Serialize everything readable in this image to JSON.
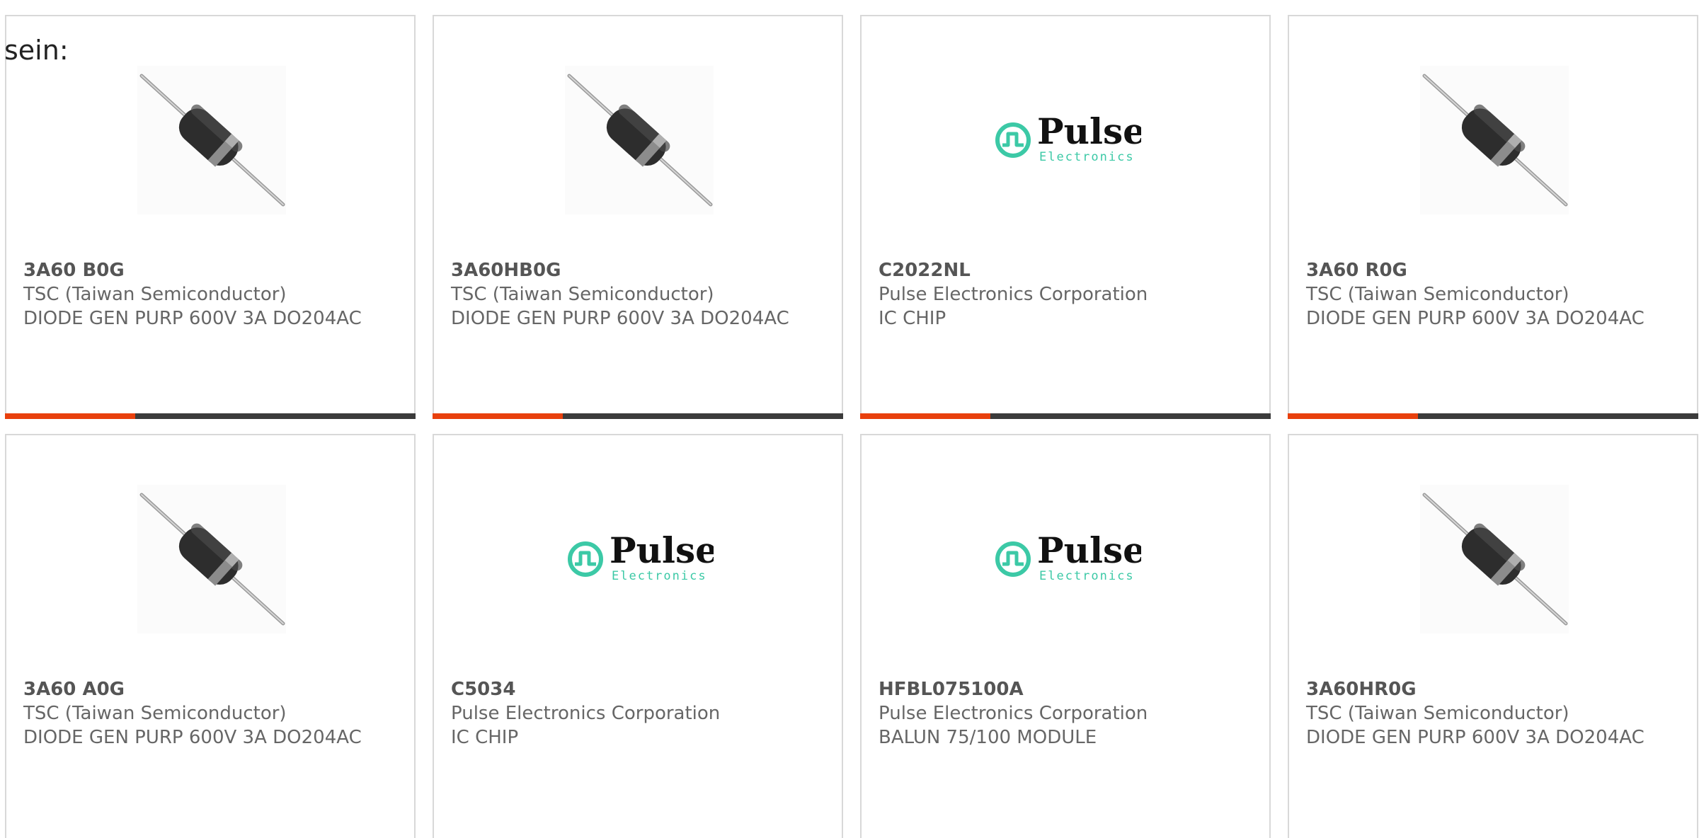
{
  "intro_text": "sein:",
  "colors": {
    "accent": "#e8400d",
    "bar": "#3b3b3b",
    "border": "#d8d8d8",
    "pulse_teal": "#3cc9a6"
  },
  "products": [
    {
      "part": "3A60 B0G",
      "manufacturer": "TSC (Taiwan Semiconductor)",
      "description": "DIODE GEN PURP 600V 3A DO204AC",
      "image": "diode-icon"
    },
    {
      "part": "3A60HB0G",
      "manufacturer": "TSC (Taiwan Semiconductor)",
      "description": "DIODE GEN PURP 600V 3A DO204AC",
      "image": "diode-icon"
    },
    {
      "part": "C2022NL",
      "manufacturer": "Pulse Electronics Corporation",
      "description": "IC CHIP",
      "image": "pulse-logo"
    },
    {
      "part": "3A60 R0G",
      "manufacturer": "TSC (Taiwan Semiconductor)",
      "description": "DIODE GEN PURP 600V 3A DO204AC",
      "image": "diode-icon"
    },
    {
      "part": "3A60 A0G",
      "manufacturer": "TSC (Taiwan Semiconductor)",
      "description": "DIODE GEN PURP 600V 3A DO204AC",
      "image": "diode-icon"
    },
    {
      "part": "C5034",
      "manufacturer": "Pulse Electronics Corporation",
      "description": "IC CHIP",
      "image": "pulse-logo"
    },
    {
      "part": "HFBL075100A",
      "manufacturer": "Pulse Electronics Corporation",
      "description": "BALUN 75/100 MODULE",
      "image": "pulse-logo"
    },
    {
      "part": "3A60HR0G",
      "manufacturer": "TSC (Taiwan Semiconductor)",
      "description": "DIODE GEN PURP 600V 3A DO204AC",
      "image": "diode-icon"
    }
  ],
  "pulse_logo": {
    "brand": "Pulse",
    "sub": "Electronics"
  }
}
